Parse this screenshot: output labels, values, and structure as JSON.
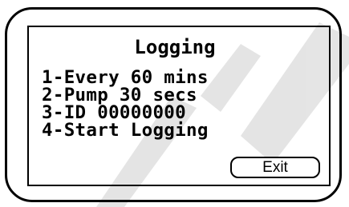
{
  "screen": {
    "title": "Logging",
    "menu_items": [
      "1-Every 60 mins",
      "2-Pump 30 secs",
      "3-ID 00000000",
      "4-Start Logging"
    ],
    "exit_label": "Exit"
  }
}
